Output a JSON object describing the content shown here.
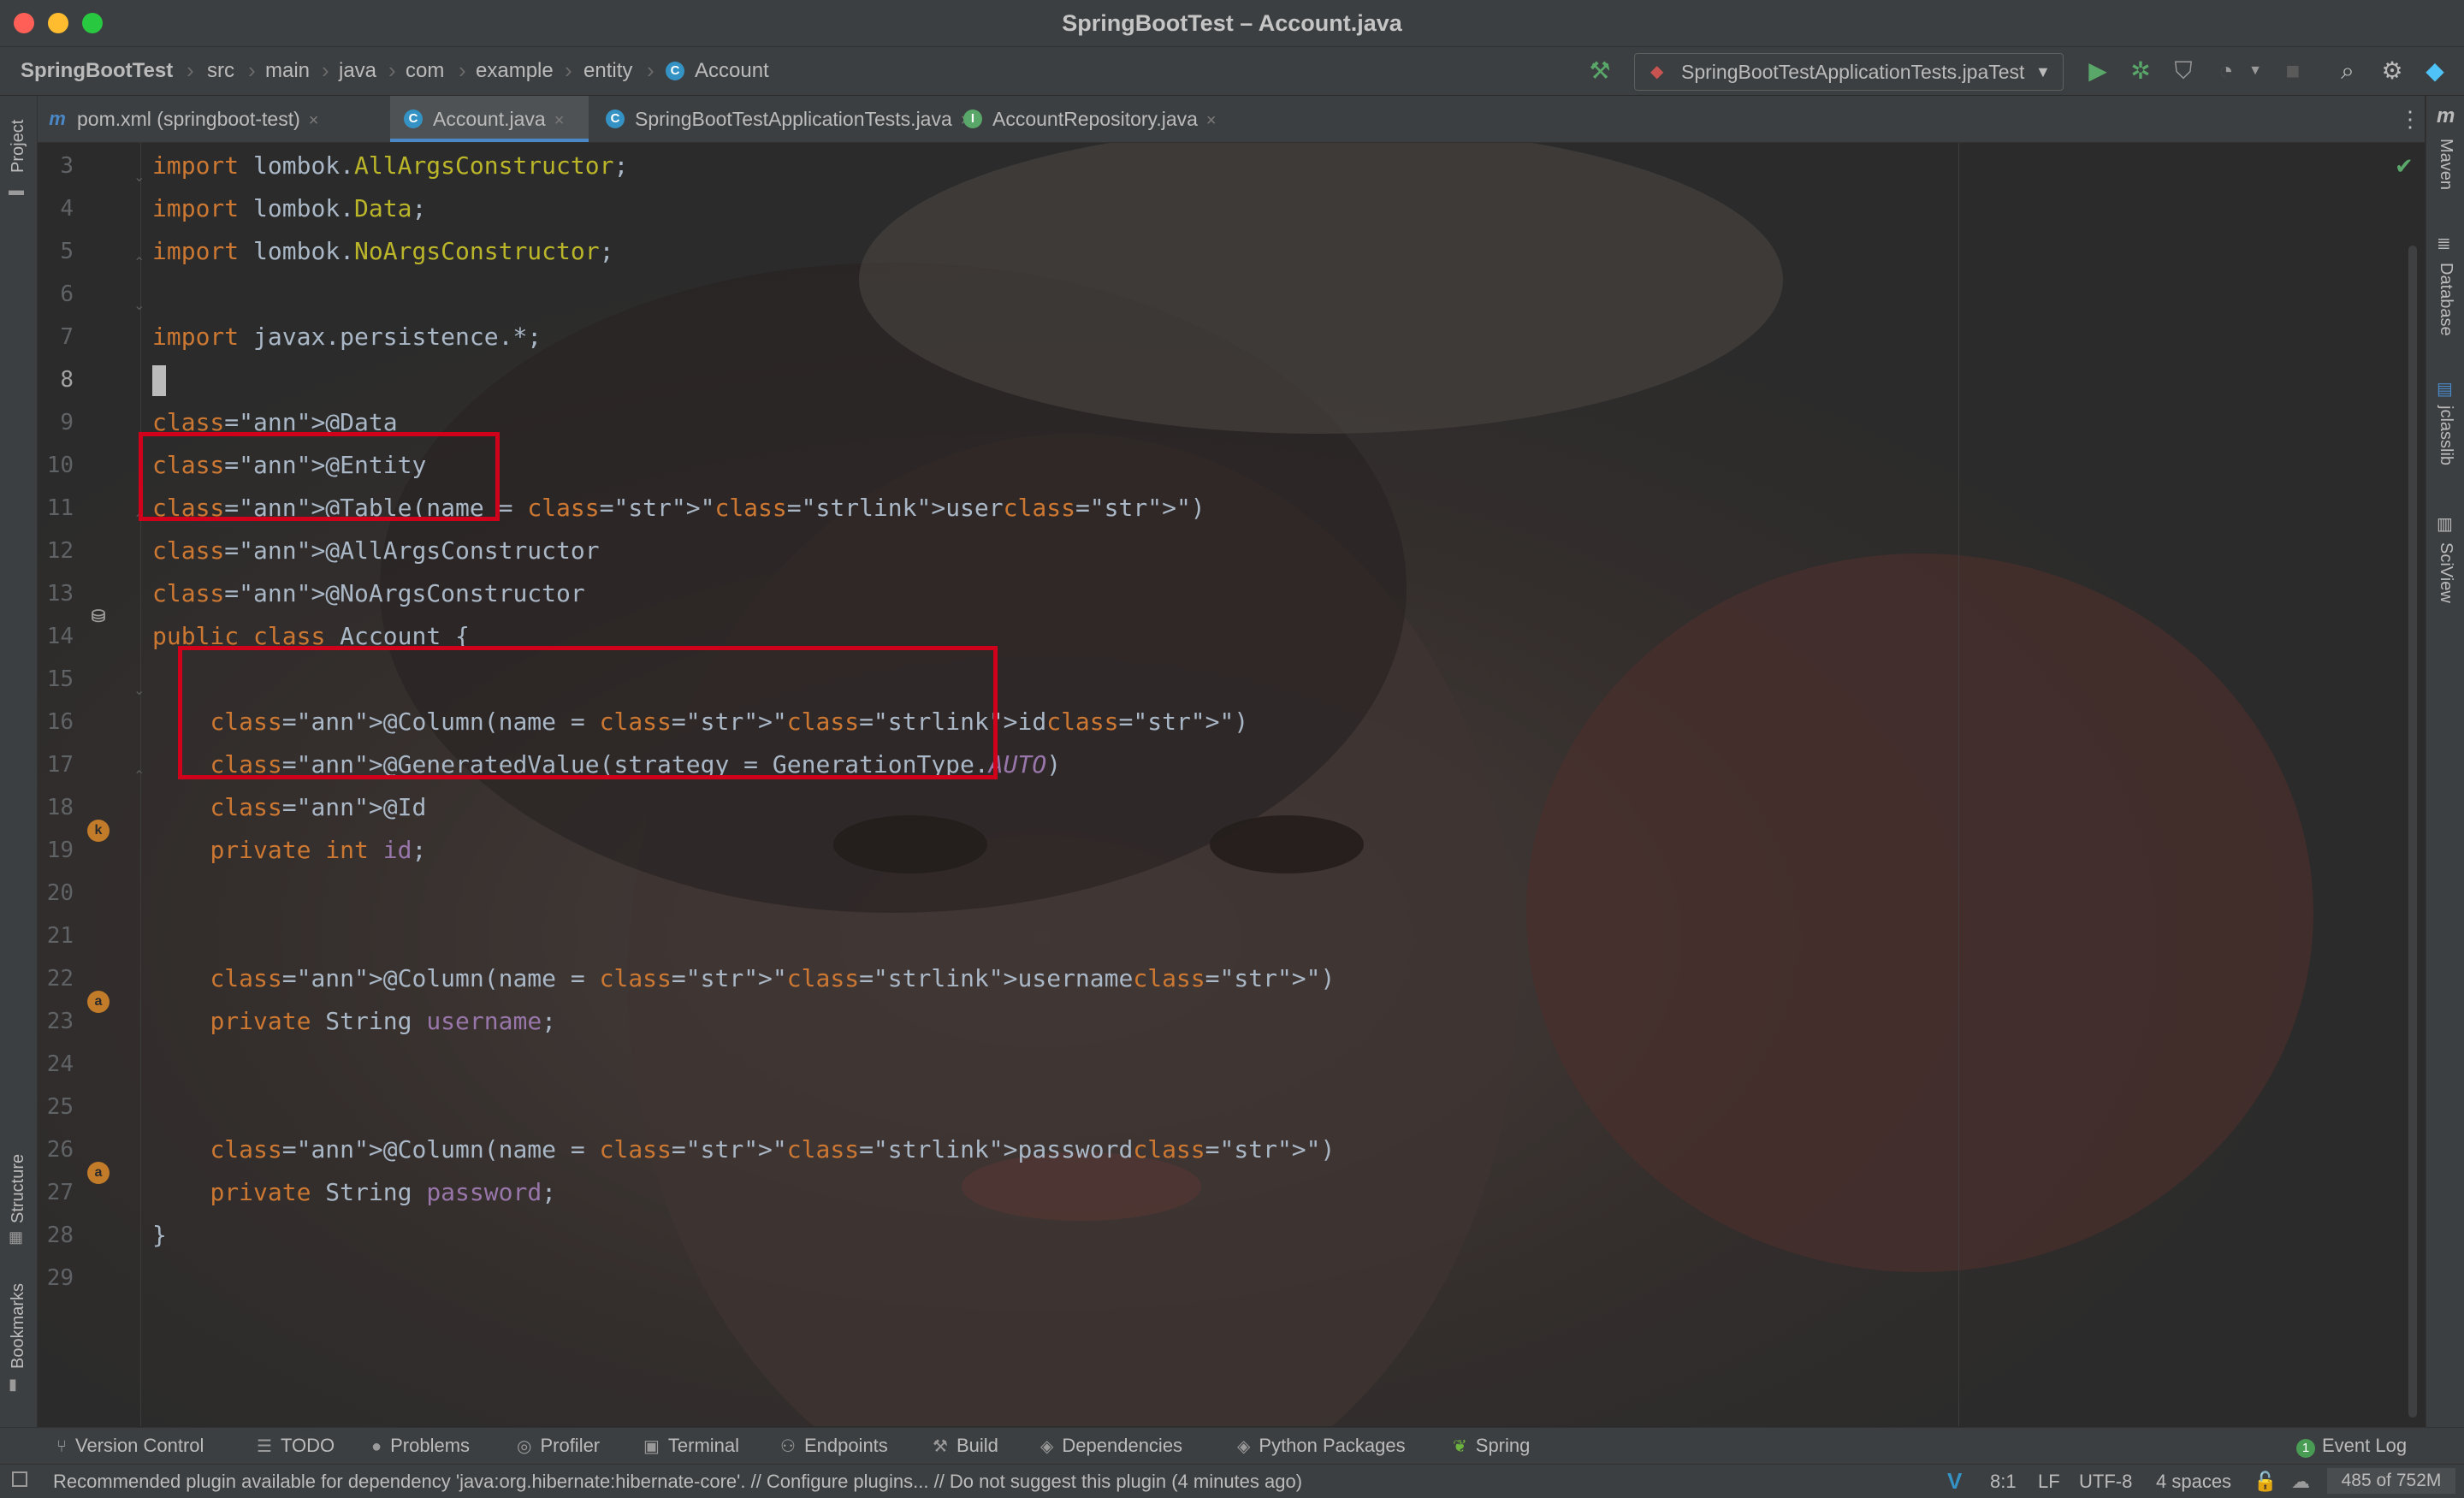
{
  "window": {
    "title": "SpringBootTest – Account.java"
  },
  "breadcrumbs": [
    "SpringBootTest",
    "src",
    "main",
    "java",
    "com",
    "example",
    "entity",
    "Account"
  ],
  "run_config": {
    "label": "SpringBootTestApplicationTests.jpaTest"
  },
  "tabs": [
    {
      "label": "pom.xml (springboot-test)",
      "icon": "maven-icon",
      "active": false
    },
    {
      "label": "Account.java",
      "icon": "class-icon",
      "active": true
    },
    {
      "label": "SpringBootTestApplicationTests.java",
      "icon": "class-icon",
      "active": false
    },
    {
      "label": "AccountRepository.java",
      "icon": "interface-icon",
      "active": false
    }
  ],
  "left_stripe": {
    "project": "Project",
    "structure": "Structure",
    "bookmarks": "Bookmarks"
  },
  "right_stripe": {
    "maven": "Maven",
    "database": "Database",
    "jclasslib": "jclasslib",
    "sciview": "SciView"
  },
  "editor": {
    "current_line": "8",
    "lines": [
      {
        "n": "3",
        "code": "import lombok.AllArgsConstructor;"
      },
      {
        "n": "4",
        "code": "import lombok.Data;"
      },
      {
        "n": "5",
        "code": "import lombok.NoArgsConstructor;"
      },
      {
        "n": "6",
        "code": ""
      },
      {
        "n": "7",
        "code": "import javax.persistence.*;"
      },
      {
        "n": "8",
        "code": ""
      },
      {
        "n": "9",
        "code": "@Data"
      },
      {
        "n": "10",
        "code": "@Entity"
      },
      {
        "n": "11",
        "code": "@Table(name = \"user\")"
      },
      {
        "n": "12",
        "code": "@AllArgsConstructor"
      },
      {
        "n": "13",
        "code": "@NoArgsConstructor"
      },
      {
        "n": "14",
        "code": "public class Account {"
      },
      {
        "n": "15",
        "code": ""
      },
      {
        "n": "16",
        "code": "    @Column(name = \"id\")"
      },
      {
        "n": "17",
        "code": "    @GeneratedValue(strategy = GenerationType.AUTO)"
      },
      {
        "n": "18",
        "code": "    @Id"
      },
      {
        "n": "19",
        "code": "    private int id;"
      },
      {
        "n": "20",
        "code": ""
      },
      {
        "n": "21",
        "code": ""
      },
      {
        "n": "22",
        "code": "    @Column(name = \"username\")"
      },
      {
        "n": "23",
        "code": "    private String username;"
      },
      {
        "n": "24",
        "code": ""
      },
      {
        "n": "25",
        "code": ""
      },
      {
        "n": "26",
        "code": "    @Column(name = \"password\")"
      },
      {
        "n": "27",
        "code": "    private String password;"
      },
      {
        "n": "28",
        "code": "}"
      },
      {
        "n": "29",
        "code": ""
      }
    ]
  },
  "tool_windows": [
    {
      "label": "Version Control",
      "icon": "branch-icon"
    },
    {
      "label": "TODO",
      "icon": "list-icon"
    },
    {
      "label": "Problems",
      "icon": "warning-icon"
    },
    {
      "label": "Profiler",
      "icon": "profiler-icon"
    },
    {
      "label": "Terminal",
      "icon": "terminal-icon"
    },
    {
      "label": "Endpoints",
      "icon": "endpoints-icon"
    },
    {
      "label": "Build",
      "icon": "hammer-icon"
    },
    {
      "label": "Dependencies",
      "icon": "dependencies-icon"
    },
    {
      "label": "Python Packages",
      "icon": "packages-icon"
    },
    {
      "label": "Spring",
      "icon": "spring-icon"
    }
  ],
  "event_log": {
    "label": "Event Log",
    "count": "1"
  },
  "status": {
    "message": "Recommended plugin available for dependency 'java:org.hibernate:hibernate-core'. // Configure plugins... // Do not suggest this plugin (4 minutes ago)",
    "position": "8:1",
    "line_sep": "LF",
    "encoding": "UTF-8",
    "indent": "4 spaces",
    "memory": "485 of 752M"
  },
  "colors": {
    "background": "#2b2b2b",
    "panel": "#3c3f41",
    "keyword": "#cc7832",
    "annotation": "#bbb529",
    "string": "#6a8759",
    "field": "#9876aa",
    "highlight_box": "#d0021b"
  }
}
